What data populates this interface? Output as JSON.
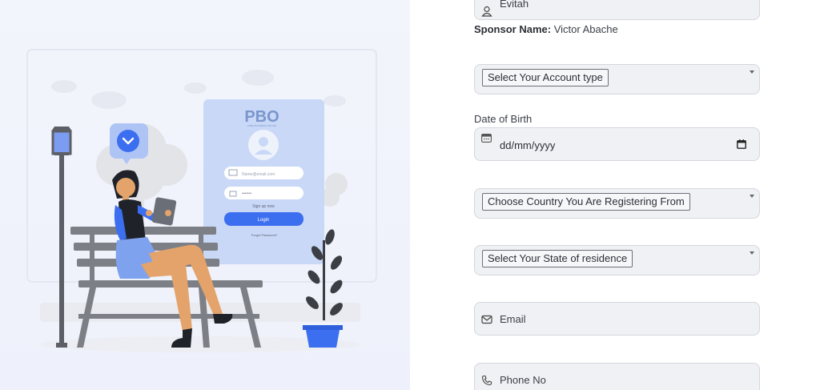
{
  "illustration": {
    "logo_text": "PBO",
    "logo_subtext": "FREE BUSINESS ONLINE",
    "email_placeholder": "Name@email.com",
    "password_mask": "•••••••",
    "signup_text": "Sign up now",
    "login_label": "Login",
    "forgot_text": "Forgot Password?"
  },
  "form": {
    "username": {
      "value": "Evitah",
      "icon": "user-icon"
    },
    "sponsor": {
      "label": "Sponsor Name:",
      "value": "Victor Abache"
    },
    "account_type": {
      "selected": "Select Your Account type"
    },
    "dob": {
      "label": "Date of Birth",
      "placeholder": "dd/mm/yyyy",
      "icon": "calendar-icon"
    },
    "country": {
      "selected": "Choose Country You Are Registering From"
    },
    "state": {
      "selected": "Select Your State of residence"
    },
    "email": {
      "placeholder": "Email",
      "icon": "mail-icon"
    },
    "phone": {
      "placeholder": "Phone No",
      "icon": "phone-icon"
    }
  },
  "colors": {
    "panel_bg": "#f3f5fc",
    "field_bg": "#f0f1f4",
    "field_border": "#d4d7de",
    "brand_blue": "#3c6ef0",
    "card_blue": "#c9d8f7"
  }
}
